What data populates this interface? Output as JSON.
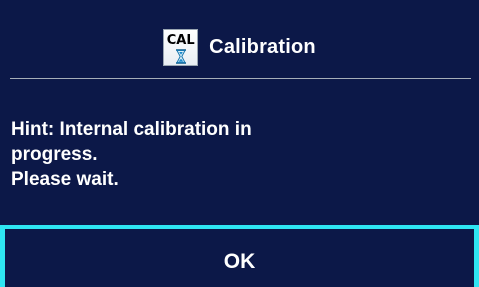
{
  "dialog": {
    "icon_label": "CAL",
    "icon_name": "calibration-hourglass-icon",
    "title": "Calibration",
    "message_lines": [
      "Hint: Internal calibration in",
      "progress.",
      "Please wait."
    ],
    "ok_label": "OK"
  },
  "colors": {
    "background": "#0c1848",
    "text": "#ffffff",
    "divider": "#a6aeb8",
    "focus_border": "#2ee6f2"
  }
}
